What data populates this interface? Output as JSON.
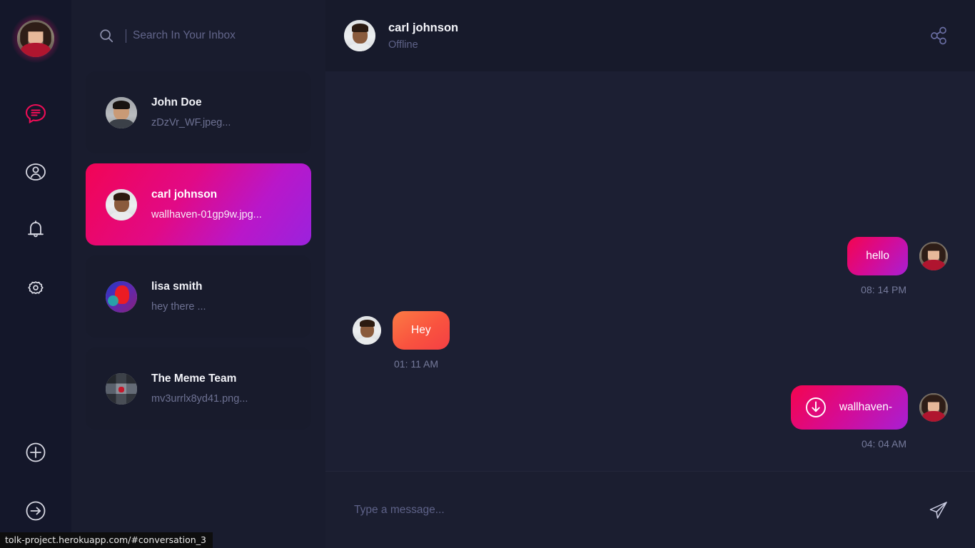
{
  "app": {
    "status_bar_url": "tolk-project.herokuapp.com/#conversation_3"
  },
  "rail": {
    "avatar_name": "current-user-avatar",
    "items": [
      {
        "id": "chats",
        "icon": "chat-icon",
        "label": "Chats",
        "active": true
      },
      {
        "id": "contacts",
        "icon": "contacts-icon",
        "label": "Contacts",
        "active": false
      },
      {
        "id": "notifications",
        "icon": "bell-icon",
        "label": "Notifications",
        "active": false
      },
      {
        "id": "settings",
        "icon": "gear-icon",
        "label": "Settings",
        "active": false
      }
    ],
    "bottom_items": [
      {
        "id": "add",
        "icon": "plus-circle-icon",
        "label": "New Conversation"
      },
      {
        "id": "logout",
        "icon": "logout-arrow-icon",
        "label": "Log Out"
      }
    ]
  },
  "search": {
    "icon": "search-icon",
    "value": "",
    "placeholder": "Search In Your Inbox"
  },
  "conversations": [
    {
      "name": "John Doe",
      "preview": "zDzVr_WF.jpeg...",
      "avatar": "john",
      "active": false
    },
    {
      "name": "carl johnson",
      "preview": "wallhaven-01gp9w.jpg...",
      "avatar": "carl",
      "active": true
    },
    {
      "name": "lisa smith",
      "preview": "hey there ...",
      "avatar": "lisa",
      "active": false
    },
    {
      "name": "The Meme Team",
      "preview": "mv3urrlx8yd41.png...",
      "avatar": "meme",
      "active": false
    }
  ],
  "chat_header": {
    "name": "carl johnson",
    "status": "Offline",
    "share_icon": "share-icon"
  },
  "messages": [
    {
      "direction": "out",
      "type": "text",
      "text": "hello",
      "time": "08: 14 PM",
      "style": "grad-pink",
      "avatar": "girl1"
    },
    {
      "direction": "in",
      "type": "text",
      "text": "Hey",
      "time": "01: 11 AM",
      "style": "grad-orange",
      "avatar": "carl"
    },
    {
      "direction": "out",
      "type": "file",
      "text": "wallhaven-",
      "time": "04: 04 AM",
      "style": "grad-pink",
      "avatar": "girl1",
      "file_icon": "download-circle-icon"
    }
  ],
  "composer": {
    "value": "",
    "placeholder": "Type a message...",
    "send_icon": "send-icon"
  },
  "colors": {
    "accent_pink": "#f4054f",
    "accent_purple": "#a81fd4",
    "accent_orange": "#fb7b44",
    "bg_dark": "#14172a",
    "bg_panel": "#191c2e",
    "bg_chat": "#1c1f33"
  }
}
